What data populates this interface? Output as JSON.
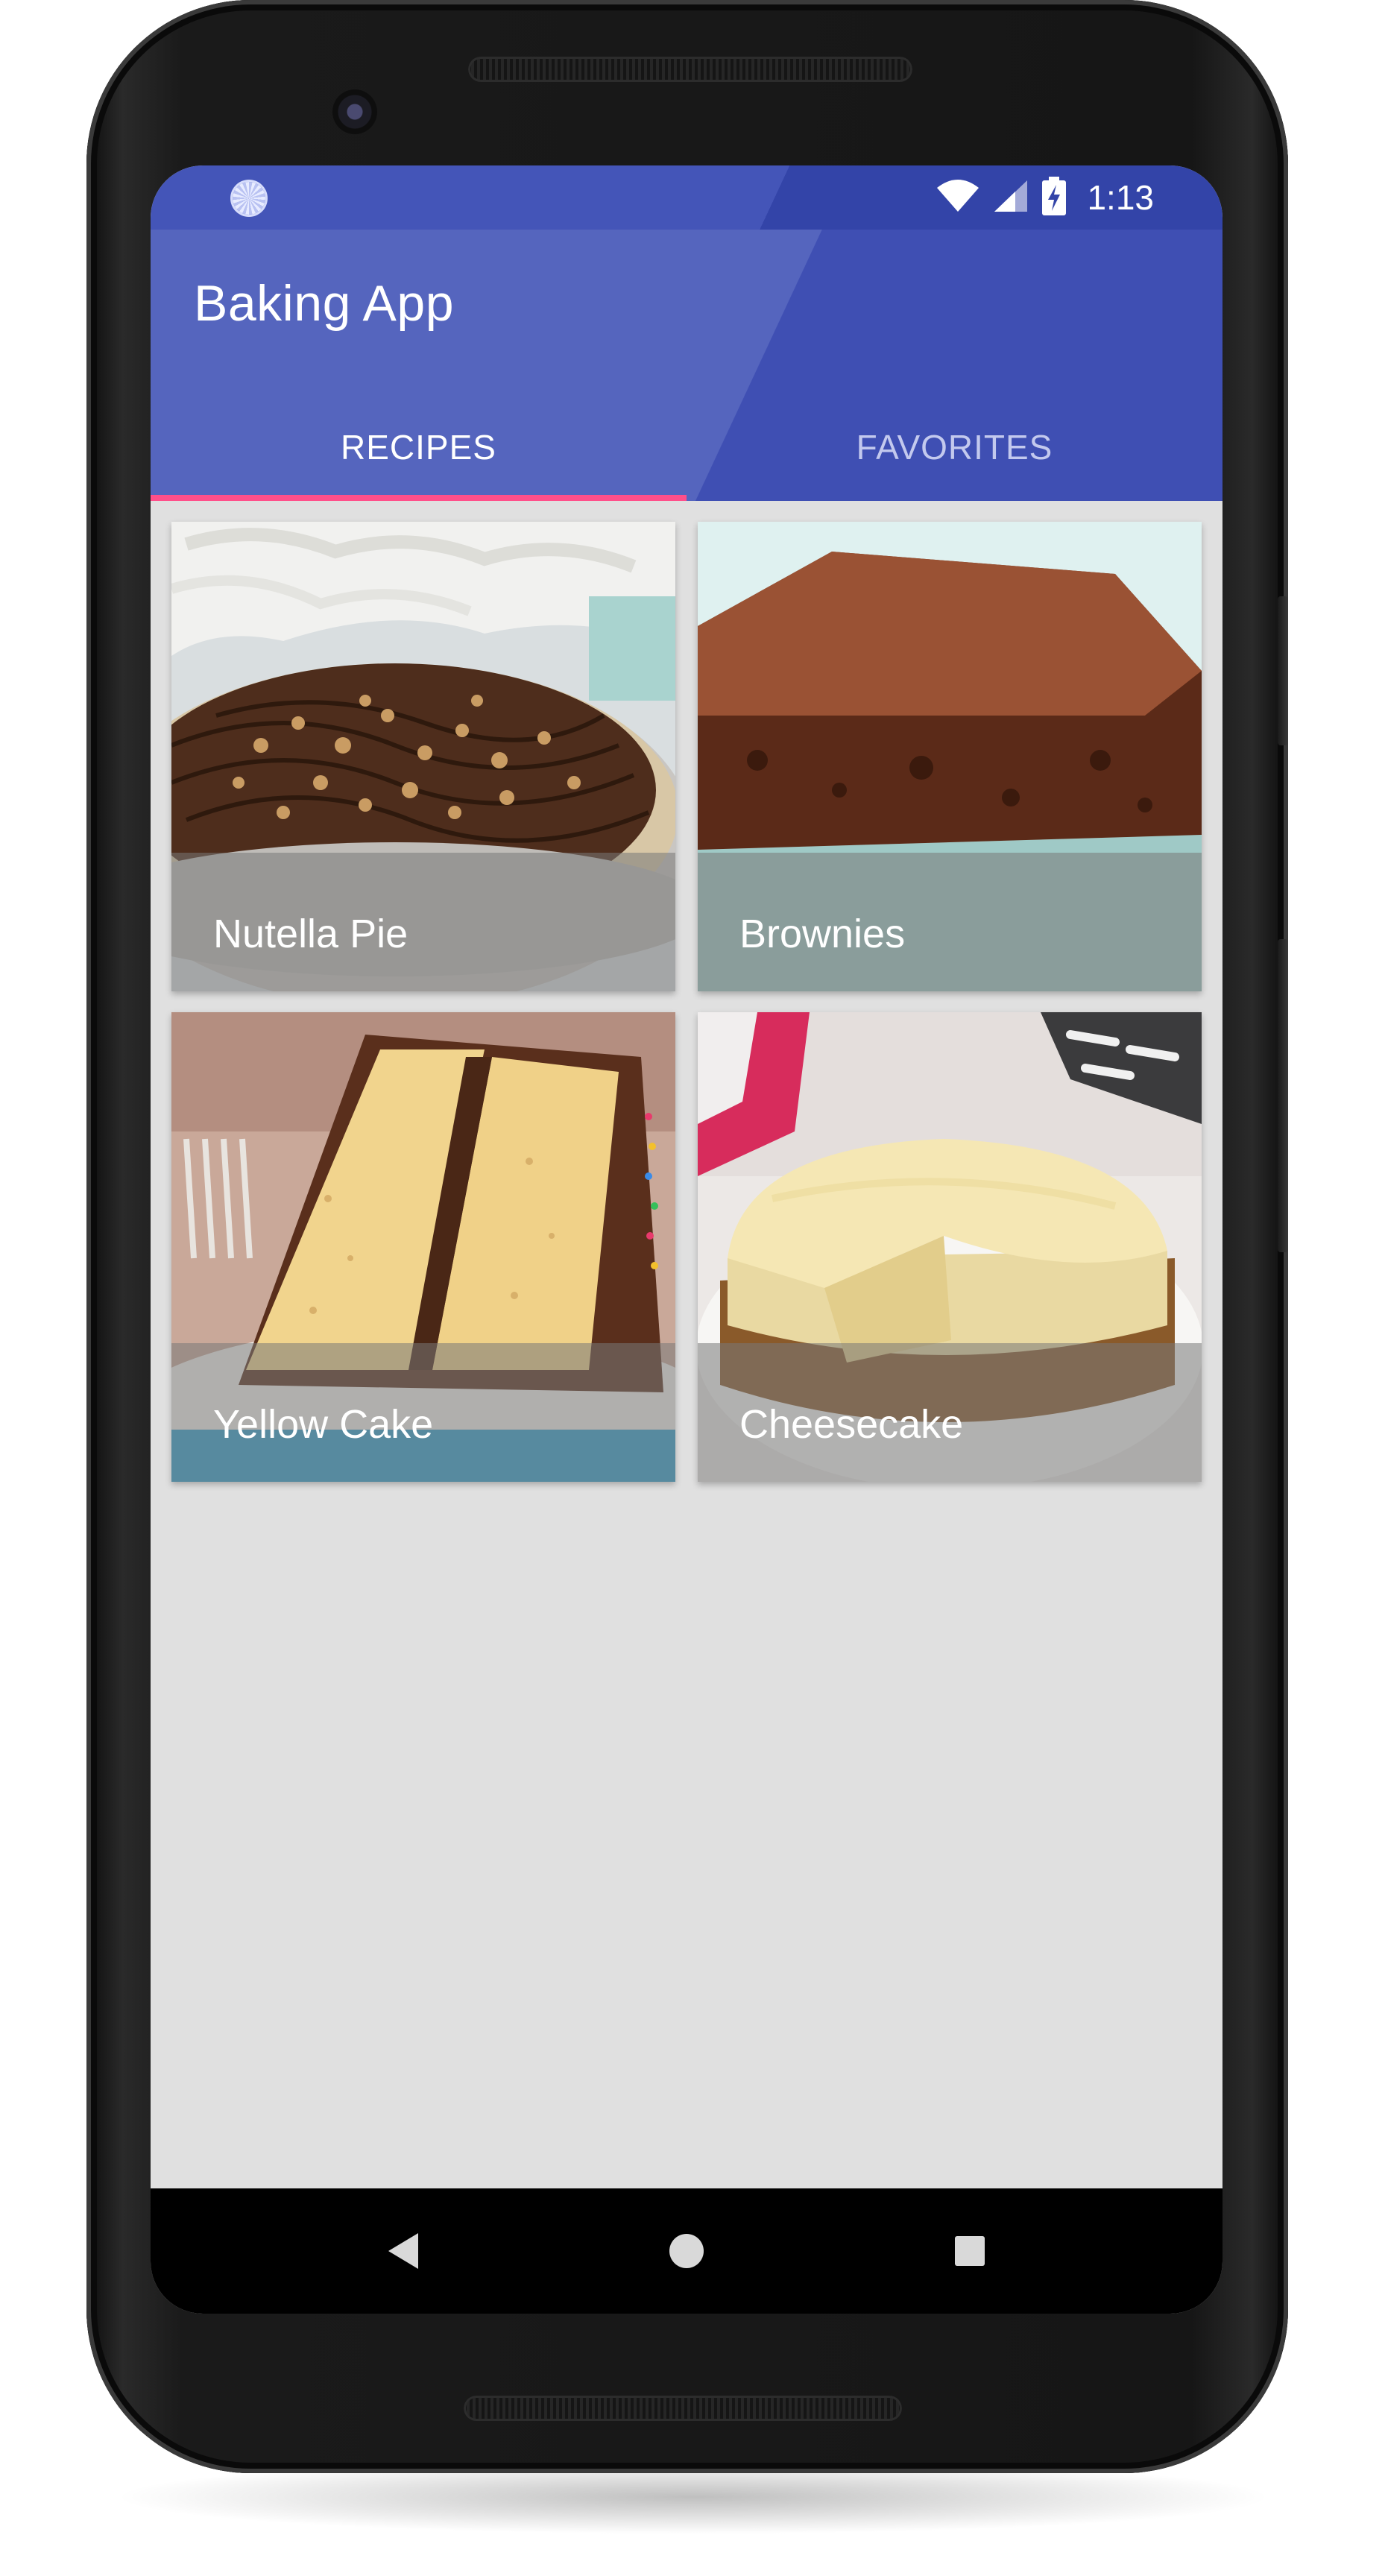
{
  "status_bar": {
    "time": "1:13",
    "icons": [
      "notification-icon",
      "wifi-icon",
      "cellular-signal-icon",
      "battery-charging-icon"
    ]
  },
  "app": {
    "title": "Baking App",
    "tabs": [
      {
        "label": "RECIPES",
        "selected": true
      },
      {
        "label": "FAVORITES",
        "selected": false
      }
    ]
  },
  "recipes": [
    {
      "name": "Nutella Pie"
    },
    {
      "name": "Brownies"
    },
    {
      "name": "Yellow Cake"
    },
    {
      "name": "Cheesecake"
    }
  ],
  "navigation": {
    "icons": [
      "back-icon",
      "home-icon",
      "recents-icon"
    ]
  },
  "colors": {
    "primary": "#3f51b5",
    "accent": "#ff4081",
    "background": "#e0e0e0"
  }
}
